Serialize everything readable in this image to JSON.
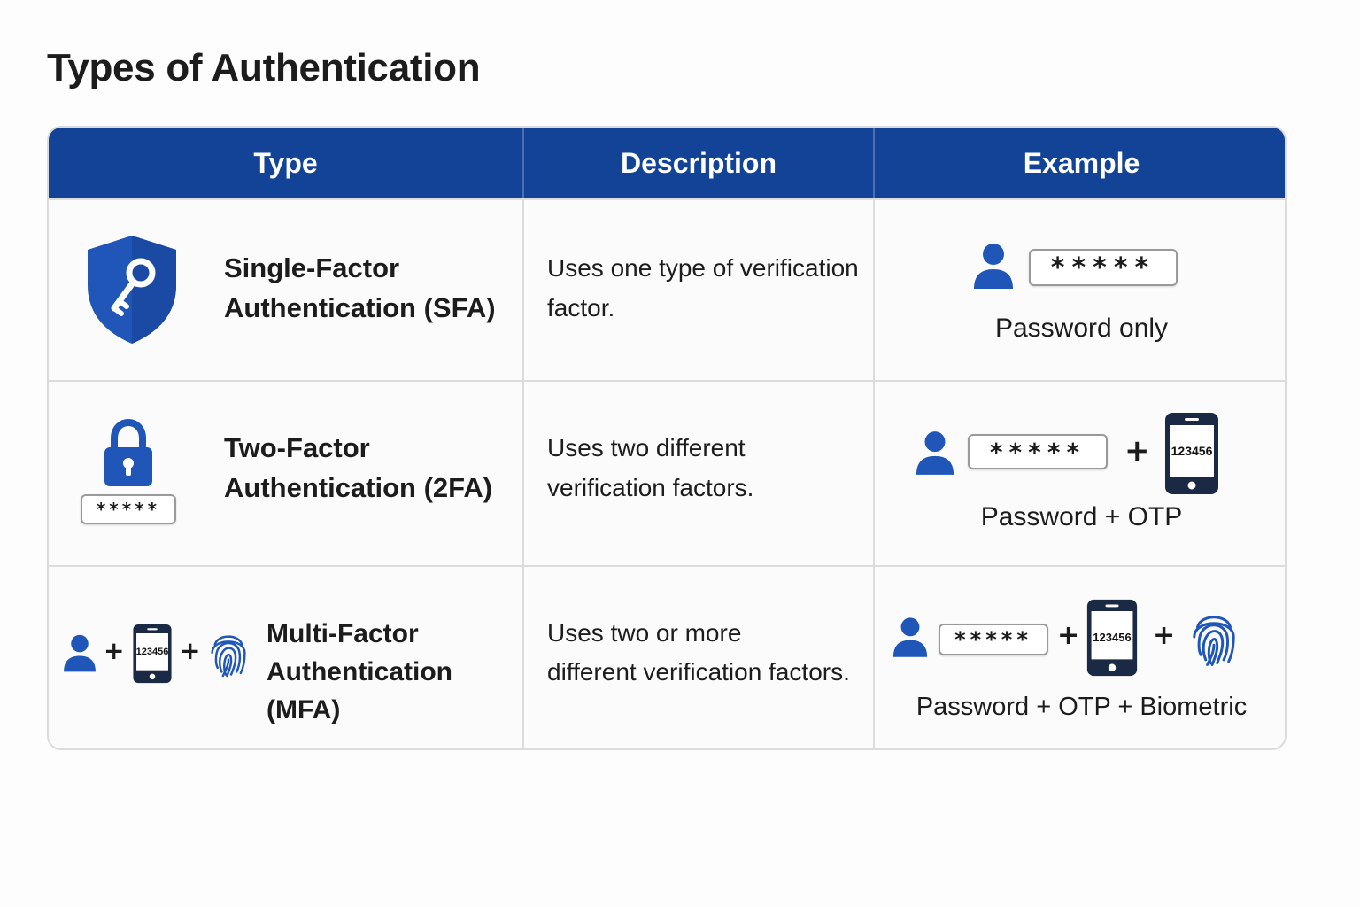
{
  "title": "Types of Authentication",
  "table": {
    "headers": [
      "Type",
      "Description",
      "Example"
    ],
    "rows": [
      {
        "type_icon": "shield-key-icon",
        "type": "Single-Factor\nAuthentication (SFA)",
        "description": "Uses one type of verification\nfactor.",
        "example_password": "*****",
        "example_caption": "Password only"
      },
      {
        "type_icon": "padlock-icon",
        "type_password": "*****",
        "type": "Two-Factor\nAuthentication (2FA)",
        "description": "Uses two different\nverification factors.",
        "example_password": "*****",
        "example_otp": "123456",
        "example_caption": "Password + OTP"
      },
      {
        "type_otp": "123456",
        "type": "Multi-Factor\nAuthentication (MFA)",
        "description": "Uses two or more\ndifferent verification factors.",
        "example_password": "*****",
        "example_otp": "123456",
        "example_caption": "Password + OTP + Biometric"
      }
    ]
  },
  "symbols": {
    "plus": "+"
  },
  "colors": {
    "header_bg": "#134397",
    "icon_blue": "#1f56b8"
  }
}
